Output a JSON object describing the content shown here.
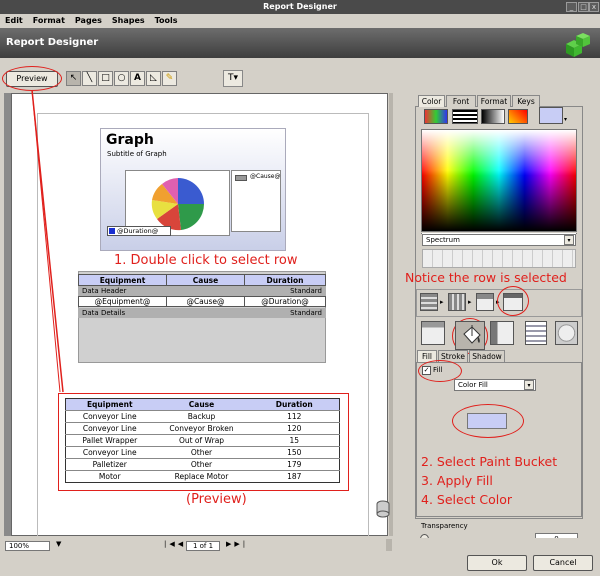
{
  "window": {
    "title": "Report Designer"
  },
  "menu": [
    "Edit",
    "Format",
    "Pages",
    "Shapes",
    "Tools"
  ],
  "header": {
    "title": "Report Designer"
  },
  "toolbar": {
    "preview_label": "Preview"
  },
  "graph": {
    "title": "Graph",
    "subtitle": "Subtitle of Graph",
    "legend_key": "@Cause@",
    "footer_label": "@Duration@"
  },
  "annotations": {
    "double_click": "1. Double click to select row",
    "notice": "Notice the row is selected",
    "preview": "(Preview)",
    "step2": "2. Select Paint Bucket",
    "step3": "3. Apply Fill",
    "step4": "4. Select Color"
  },
  "design_table": {
    "headers": [
      "Equipment",
      "Cause",
      "Duration"
    ],
    "data_header_label": "Data Header",
    "standard": "Standard",
    "row": [
      "@Equipment@",
      "@Cause@",
      "@Duration@"
    ],
    "data_details_label": "Data Details"
  },
  "preview_table": {
    "headers": [
      "Equipment",
      "Cause",
      "Duration"
    ],
    "rows": [
      [
        "Conveyor Line",
        "Backup",
        "112"
      ],
      [
        "Conveyor Line",
        "Conveyor Broken",
        "120"
      ],
      [
        "Pallet Wrapper",
        "Out of Wrap",
        "15"
      ],
      [
        "Conveyor Line",
        "Other",
        "150"
      ],
      [
        "Palletizer",
        "Other",
        "179"
      ],
      [
        "Motor",
        "Replace Motor",
        "187"
      ]
    ]
  },
  "panel": {
    "tabs": [
      "Color",
      "Font",
      "Format",
      "Keys"
    ],
    "spectrum": "Spectrum",
    "subtabs": [
      "Fill",
      "Stroke",
      "Shadow"
    ],
    "fill_checkbox": "Fill",
    "fill_type": "Color Fill",
    "transparency_label": "Transparency",
    "transparency_value": "0"
  },
  "status": {
    "zoom": "100%",
    "page": "1 of 1"
  },
  "buttons": {
    "ok": "Ok",
    "cancel": "Cancel"
  },
  "colors": {
    "accent_red": "#e0201c",
    "selected_fill": "#c8cdf5",
    "highlight": "#e6e0ff"
  }
}
